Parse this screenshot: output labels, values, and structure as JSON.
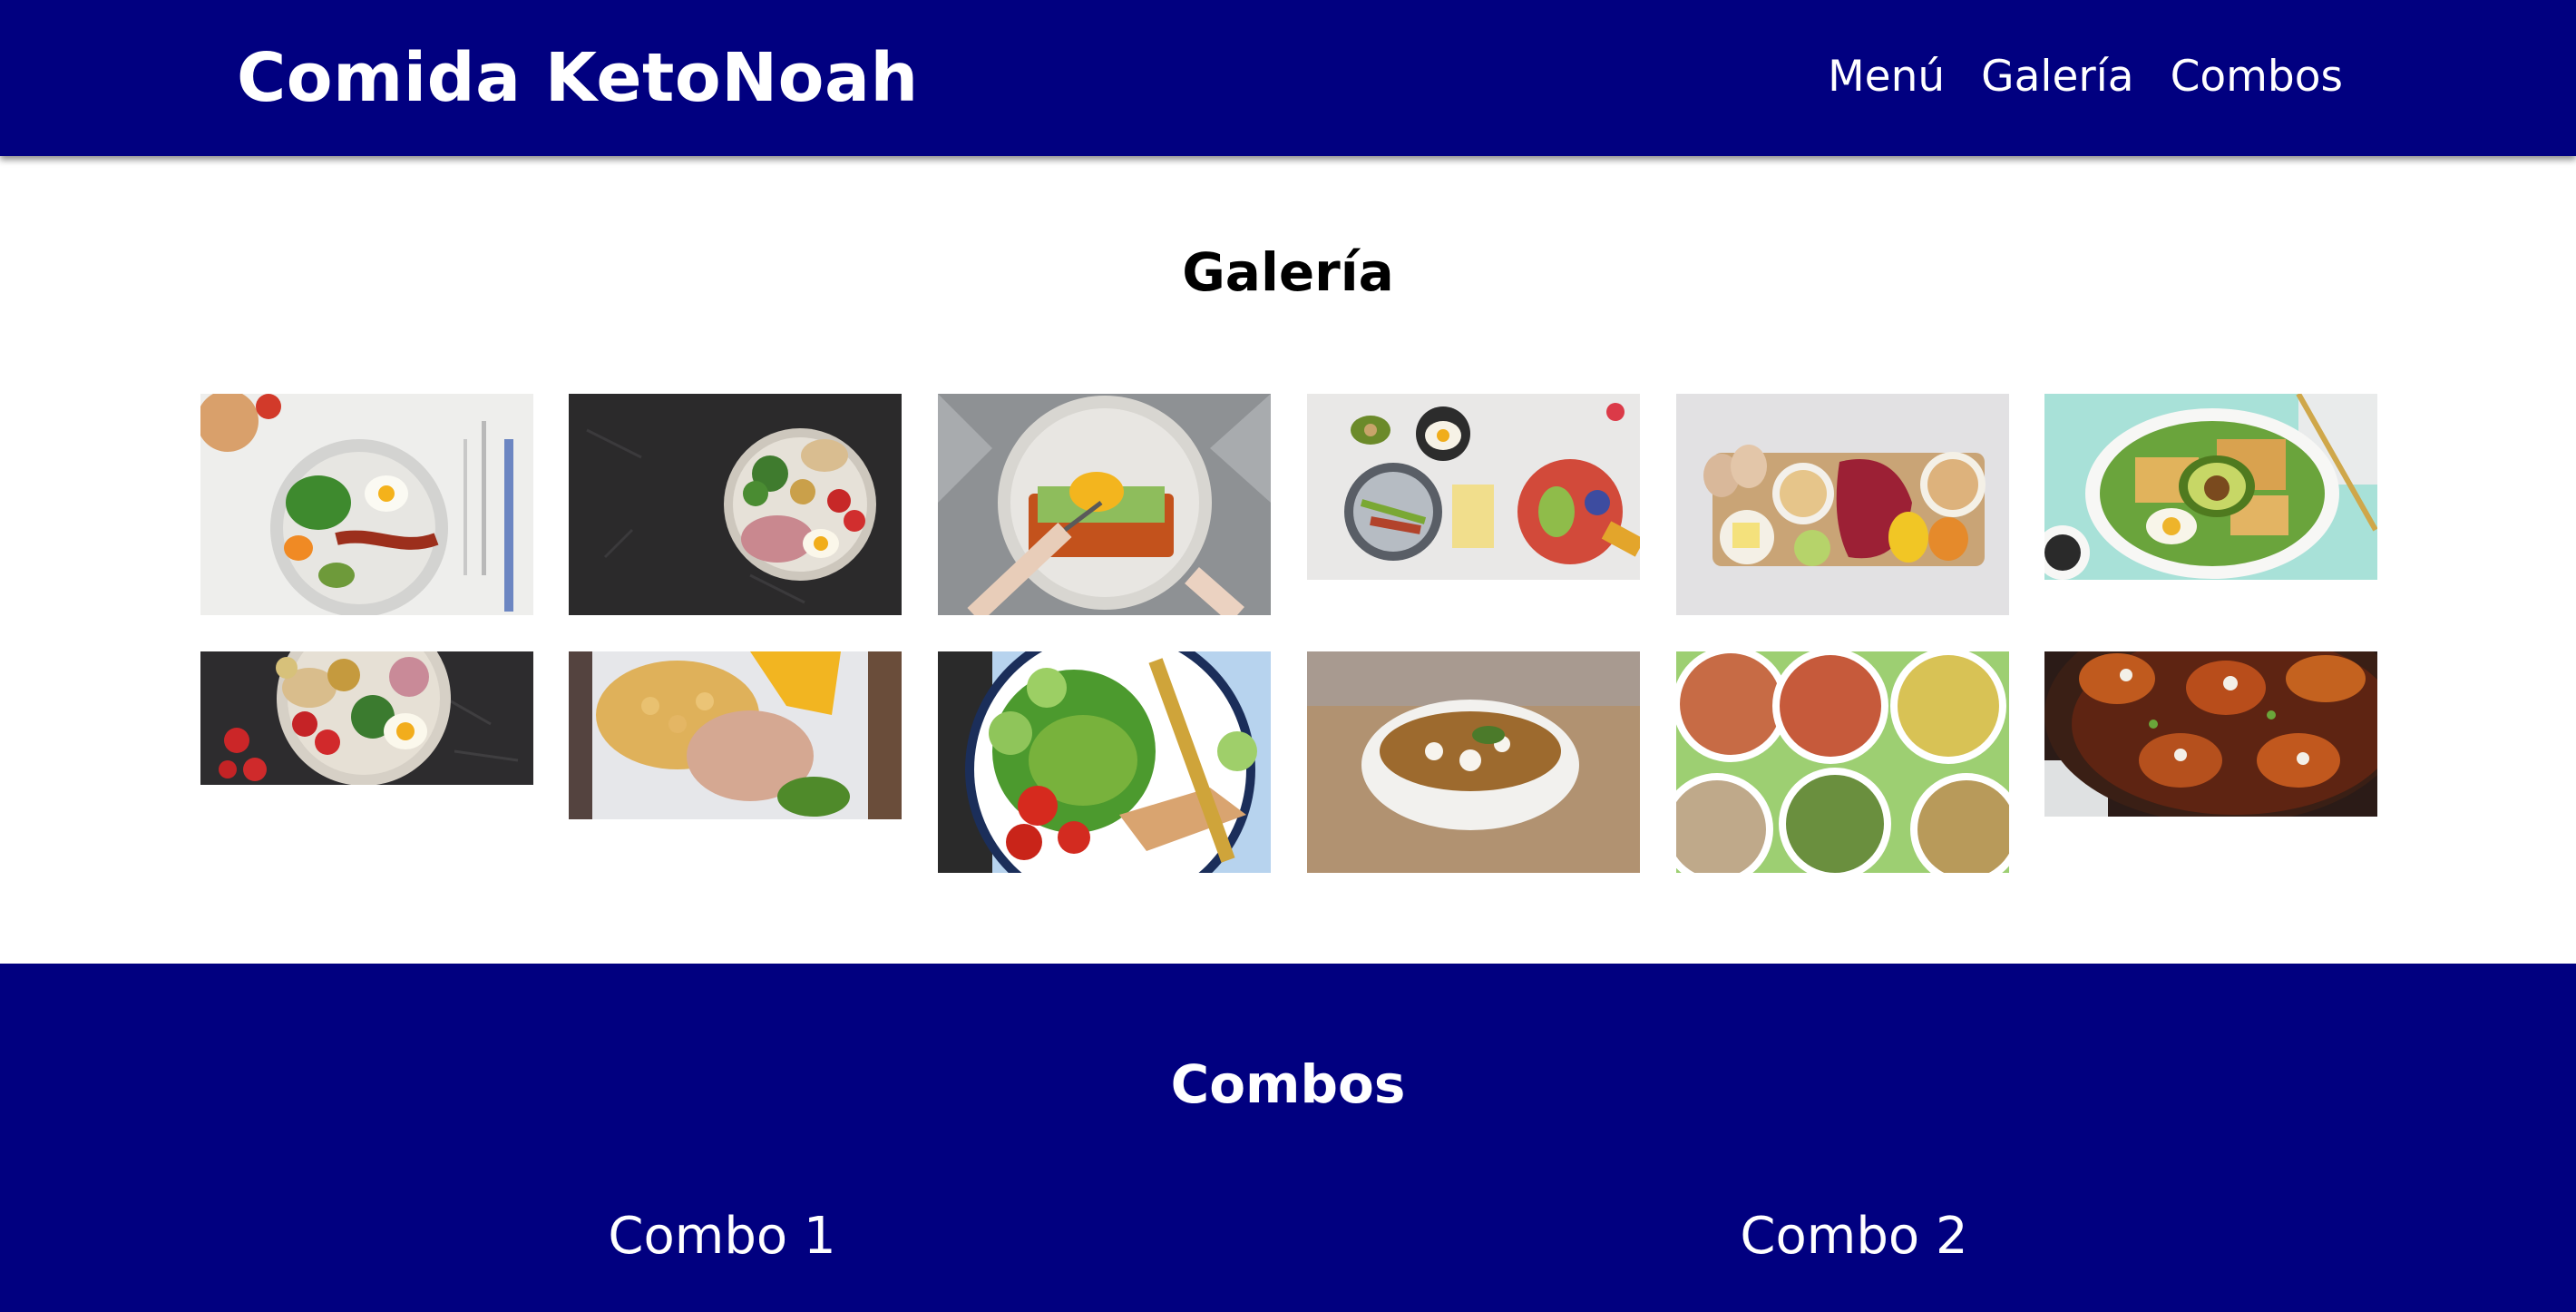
{
  "header": {
    "brand": "Comida KetoNoah",
    "nav": [
      "Menú",
      "Galería",
      "Combos"
    ]
  },
  "gallery": {
    "title": "Galería",
    "images": [
      "keto-breakfast-plate-photo",
      "ham-broccoli-strawberry-plate-photo",
      "avocado-egg-toast-photo",
      "keto-ingredients-flatlay-photo",
      "eggs-nuts-cheese-meat-board-photo",
      "halloumi-avocado-salad-photo",
      "strawberry-egg-nut-plate-photo",
      "chickpeas-chicken-plantain-photo",
      "chicken-avocado-salad-photo",
      "lentil-stew-bowl-photo",
      "zucchini-noodle-bowls-photo",
      "chicken-skillet-sauce-photo"
    ]
  },
  "combos": {
    "title": "Combos",
    "items": [
      "Combo 1",
      "Combo 2"
    ]
  },
  "colors": {
    "primary": "#010080",
    "text_on_primary": "#ffffff",
    "page_background": "#ffffff"
  }
}
